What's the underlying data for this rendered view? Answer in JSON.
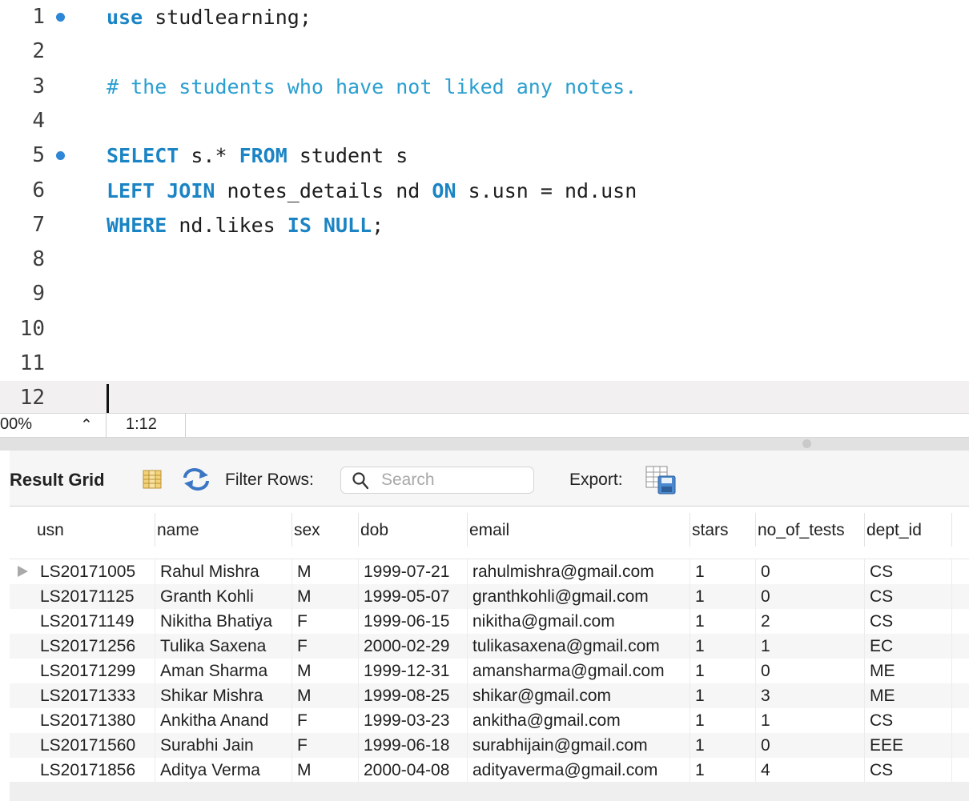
{
  "editor": {
    "lines": [
      {
        "num": "1",
        "bp": true,
        "tokens": [
          {
            "t": "use",
            "c": "kw"
          },
          {
            "t": " studlearning;",
            "c": ""
          }
        ]
      },
      {
        "num": "2",
        "bp": false,
        "tokens": []
      },
      {
        "num": "3",
        "bp": false,
        "tokens": [
          {
            "t": "# the students who have not liked any notes.",
            "c": "cm"
          }
        ]
      },
      {
        "num": "4",
        "bp": false,
        "tokens": []
      },
      {
        "num": "5",
        "bp": true,
        "tokens": [
          {
            "t": "SELECT",
            "c": "kw"
          },
          {
            "t": " s.* ",
            "c": ""
          },
          {
            "t": "FROM",
            "c": "kw"
          },
          {
            "t": " student s",
            "c": ""
          }
        ]
      },
      {
        "num": "6",
        "bp": false,
        "tokens": [
          {
            "t": "LEFT JOIN",
            "c": "kw"
          },
          {
            "t": " notes_details nd ",
            "c": ""
          },
          {
            "t": "ON",
            "c": "kw"
          },
          {
            "t": " s.usn = nd.usn",
            "c": ""
          }
        ]
      },
      {
        "num": "7",
        "bp": false,
        "tokens": [
          {
            "t": "WHERE",
            "c": "kw"
          },
          {
            "t": " nd.likes ",
            "c": ""
          },
          {
            "t": "IS NULL",
            "c": "kw"
          },
          {
            "t": ";",
            "c": ""
          }
        ]
      },
      {
        "num": "8",
        "bp": false,
        "tokens": []
      },
      {
        "num": "9",
        "bp": false,
        "tokens": []
      },
      {
        "num": "10",
        "bp": false,
        "tokens": []
      },
      {
        "num": "11",
        "bp": false,
        "tokens": []
      },
      {
        "num": "12",
        "bp": false,
        "tokens": [],
        "current": true
      }
    ]
  },
  "status": {
    "zoom": "00%",
    "cursor": "1:12"
  },
  "toolbar": {
    "title": "Result Grid",
    "filter_label": "Filter Rows:",
    "search_placeholder": "Search",
    "export_label": "Export:"
  },
  "grid": {
    "columns": [
      "usn",
      "name",
      "sex",
      "dob",
      "email",
      "stars",
      "no_of_tests",
      "dept_id"
    ],
    "rows": [
      [
        "LS20171005",
        "Rahul Mishra",
        "M",
        "1999-07-21",
        "rahulmishra@gmail.com",
        "1",
        "0",
        "CS"
      ],
      [
        "LS20171125",
        "Granth Kohli",
        "M",
        "1999-05-07",
        "granthkohli@gmail.com",
        "1",
        "0",
        "CS"
      ],
      [
        "LS20171149",
        "Nikitha Bhatiya",
        "F",
        "1999-06-15",
        "nikitha@gmail.com",
        "1",
        "2",
        "CS"
      ],
      [
        "LS20171256",
        "Tulika Saxena",
        "F",
        "2000-02-29",
        "tulikasaxena@gmail.com",
        "1",
        "1",
        "EC"
      ],
      [
        "LS20171299",
        "Aman Sharma",
        "M",
        "1999-12-31",
        "amansharma@gmail.com",
        "1",
        "0",
        "ME"
      ],
      [
        "LS20171333",
        "Shikar Mishra",
        "M",
        "1999-08-25",
        "shikar@gmail.com",
        "1",
        "3",
        "ME"
      ],
      [
        "LS20171380",
        "Ankitha Anand",
        "F",
        "1999-03-23",
        "ankitha@gmail.com",
        "1",
        "1",
        "CS"
      ],
      [
        "LS20171560",
        "Surabhi Jain",
        "F",
        "1999-06-18",
        "surabhijain@gmail.com",
        "1",
        "0",
        "EEE"
      ],
      [
        "LS20171856",
        "Aditya Verma",
        "M",
        "2000-04-08",
        "adityaverma@gmail.com",
        "1",
        "4",
        "CS"
      ]
    ]
  }
}
